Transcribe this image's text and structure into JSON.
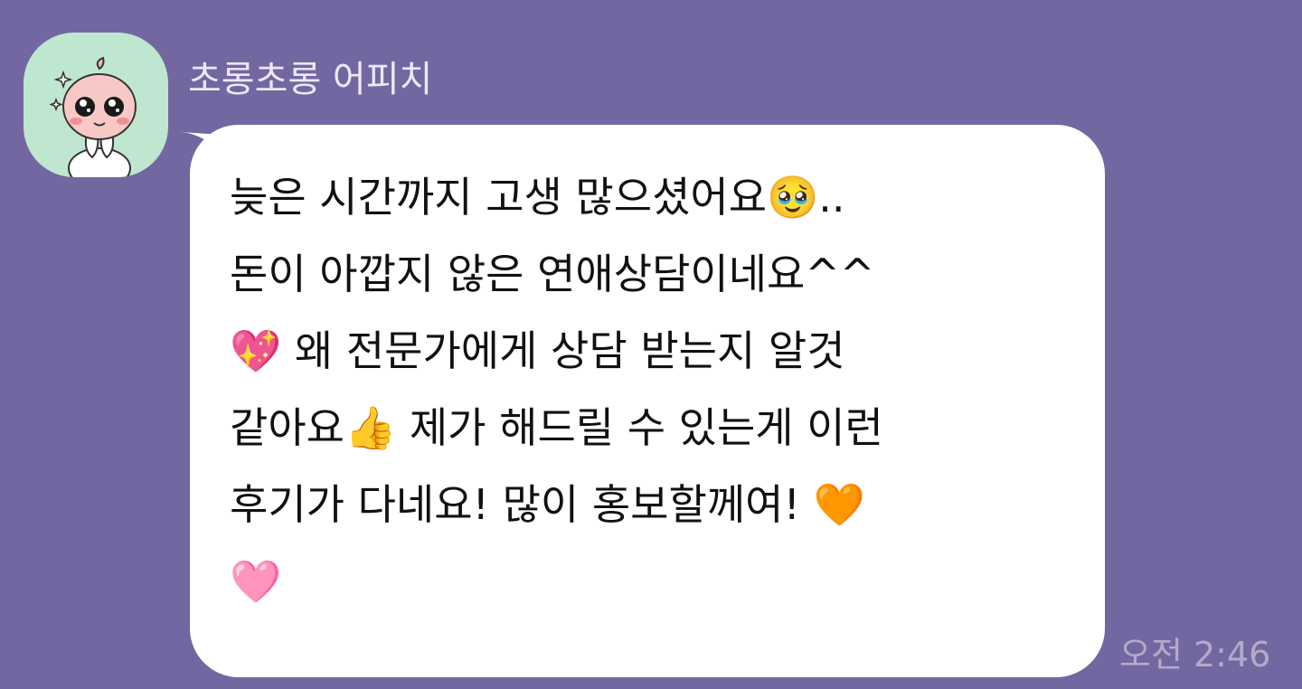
{
  "chat": {
    "sender_name": "초롱초롱 어피치",
    "avatar_icon": "apeach-character-icon",
    "message_text": "늦은 시간까지 고생 많으셨어요🥹..\n돈이 아깝지 않은 연애상담이네요^^\n💖 왜 전문가에게 상담 받는지 알것\n같아요👍 제가 해드릴 수 있는게 이런\n후기가 다네요! 많이 홍보할께여! 🧡\n🩷",
    "timestamp": "오전 2:46"
  },
  "colors": {
    "background": "#7367a1",
    "bubble": "#ffffff",
    "avatar_background": "#bfe7cf",
    "sender_text": "#ece8f6",
    "timestamp_text": "#b2abc9"
  }
}
